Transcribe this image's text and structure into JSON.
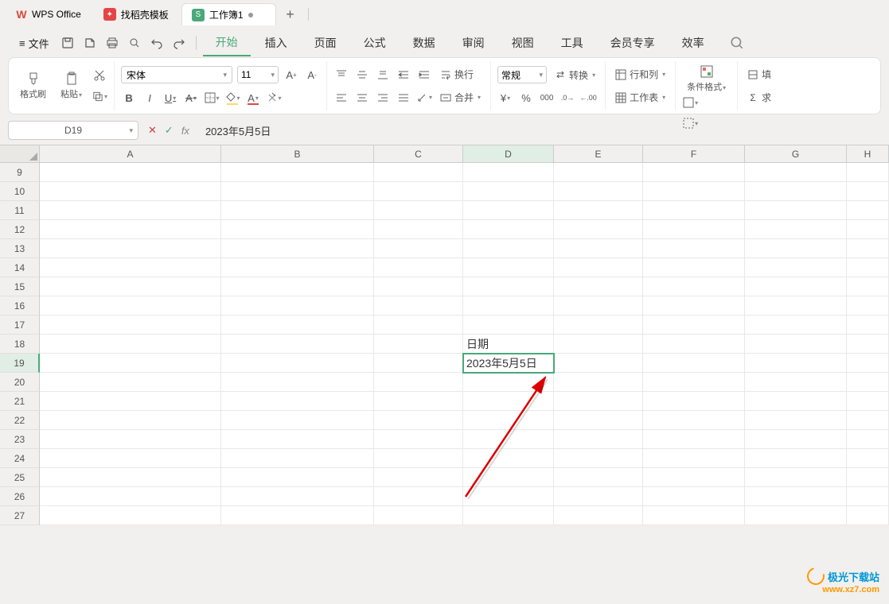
{
  "tabs": {
    "app": "WPS Office",
    "template": "找稻壳模板",
    "workbook": "工作簿1"
  },
  "menu": {
    "file": "文件",
    "items": [
      "开始",
      "插入",
      "页面",
      "公式",
      "数据",
      "审阅",
      "视图",
      "工具",
      "会员专享",
      "效率"
    ],
    "active": "开始"
  },
  "ribbon": {
    "format_brush": "格式刷",
    "paste": "粘贴",
    "font_name": "宋体",
    "font_size": "11",
    "wrap": "换行",
    "merge": "合并",
    "number_format": "常规",
    "convert": "转换",
    "rows_cols": "行和列",
    "worksheet": "工作表",
    "cond_format": "条件格式",
    "fill": "填",
    "sum": "求"
  },
  "formula_bar": {
    "name_box": "D19",
    "formula": "2023年5月5日"
  },
  "sheet": {
    "cols": [
      "A",
      "B",
      "C",
      "D",
      "E",
      "F",
      "G",
      "H"
    ],
    "rows": [
      9,
      10,
      11,
      12,
      13,
      14,
      15,
      16,
      17,
      18,
      19,
      20,
      21,
      22,
      23,
      24,
      25,
      26,
      27
    ],
    "active_col": "D",
    "active_row": 19,
    "cells": {
      "D18": "日期",
      "D19": "2023年5月5日"
    }
  },
  "watermark": {
    "line1": "极光下载站",
    "line2": "www.xz7.com"
  }
}
